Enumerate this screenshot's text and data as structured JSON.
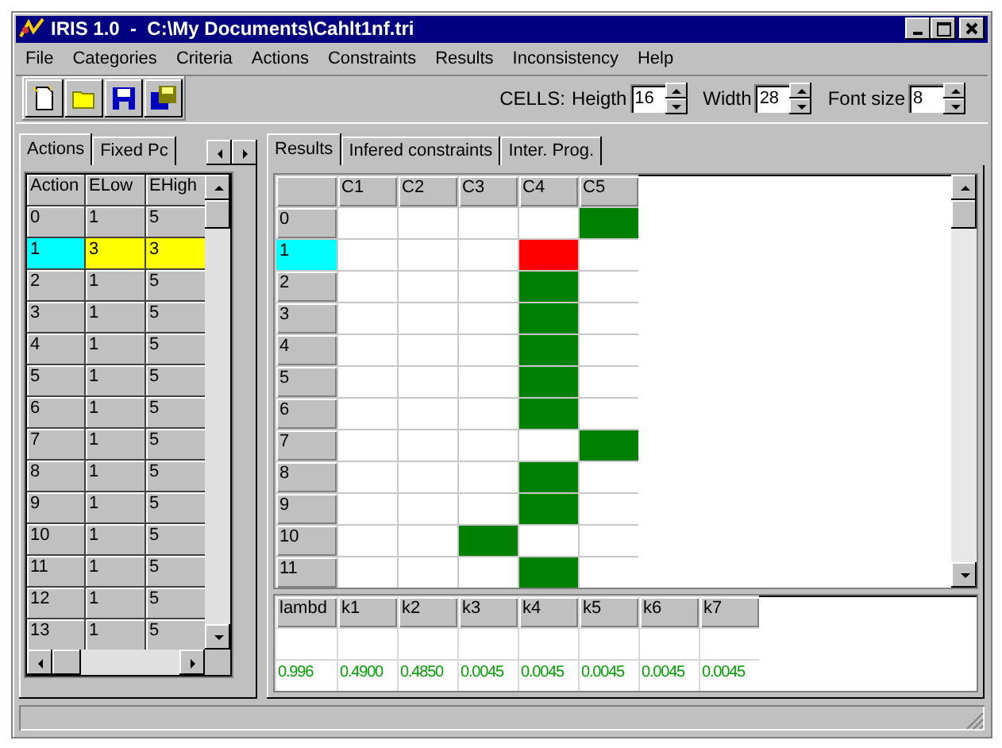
{
  "window": {
    "title": "IRIS 1.0  -  C:\\My Documents\\Cahlt1nf.tri"
  },
  "menu": [
    "File",
    "Categories",
    "Criteria",
    "Actions",
    "Constraints",
    "Results",
    "Inconsistency",
    "Help"
  ],
  "toolbar": {
    "cells_label": "CELLS:",
    "spinners": [
      {
        "label": "Heigth",
        "value": "16"
      },
      {
        "label": "Width",
        "value": "28"
      },
      {
        "label": "Font size",
        "value": "8"
      }
    ]
  },
  "left_tabs": [
    {
      "label": "Actions",
      "selected": true
    },
    {
      "label": "Fixed Pc",
      "selected": false
    }
  ],
  "actions_table": {
    "columns": [
      "Action",
      "ELow",
      "EHigh"
    ],
    "rows": [
      {
        "cells": [
          "0",
          "1",
          "5"
        ],
        "selected": false
      },
      {
        "cells": [
          "1",
          "3",
          "3"
        ],
        "selected": true
      },
      {
        "cells": [
          "2",
          "1",
          "5"
        ],
        "selected": false
      },
      {
        "cells": [
          "3",
          "1",
          "5"
        ],
        "selected": false
      },
      {
        "cells": [
          "4",
          "1",
          "5"
        ],
        "selected": false
      },
      {
        "cells": [
          "5",
          "1",
          "5"
        ],
        "selected": false
      },
      {
        "cells": [
          "6",
          "1",
          "5"
        ],
        "selected": false
      },
      {
        "cells": [
          "7",
          "1",
          "5"
        ],
        "selected": false
      },
      {
        "cells": [
          "8",
          "1",
          "5"
        ],
        "selected": false
      },
      {
        "cells": [
          "9",
          "1",
          "5"
        ],
        "selected": false
      },
      {
        "cells": [
          "10",
          "1",
          "5"
        ],
        "selected": false
      },
      {
        "cells": [
          "11",
          "1",
          "5"
        ],
        "selected": false
      },
      {
        "cells": [
          "12",
          "1",
          "5"
        ],
        "selected": false
      },
      {
        "cells": [
          "13",
          "1",
          "5"
        ],
        "selected": false
      }
    ]
  },
  "right_tabs": [
    {
      "label": "Results",
      "selected": true
    },
    {
      "label": "Infered constraints",
      "selected": false
    },
    {
      "label": "Inter. Prog.",
      "selected": false
    }
  ],
  "results_table": {
    "columns": [
      "C1",
      "C2",
      "C3",
      "C4",
      "C5"
    ],
    "rows": [
      {
        "label": "0",
        "selected": false,
        "cells": [
          {
            "color": "#ffffff"
          },
          {
            "color": "#ffffff"
          },
          {
            "color": "#ffffff"
          },
          {
            "color": "#ffffff"
          },
          {
            "color": "#008000"
          }
        ]
      },
      {
        "label": "1",
        "selected": true,
        "cells": [
          {
            "color": "#ffffff"
          },
          {
            "color": "#ffffff"
          },
          {
            "color": "#ffffff"
          },
          {
            "color": "#ff0000"
          },
          {
            "color": "#ffffff"
          }
        ]
      },
      {
        "label": "2",
        "selected": false,
        "cells": [
          {
            "color": "#ffffff"
          },
          {
            "color": "#ffffff"
          },
          {
            "color": "#ffffff"
          },
          {
            "color": "#008000"
          },
          {
            "color": "#ffffff"
          }
        ]
      },
      {
        "label": "3",
        "selected": false,
        "cells": [
          {
            "color": "#ffffff"
          },
          {
            "color": "#ffffff"
          },
          {
            "color": "#ffffff"
          },
          {
            "color": "#008000"
          },
          {
            "color": "#ffffff"
          }
        ]
      },
      {
        "label": "4",
        "selected": false,
        "cells": [
          {
            "color": "#ffffff"
          },
          {
            "color": "#ffffff"
          },
          {
            "color": "#ffffff"
          },
          {
            "color": "#008000"
          },
          {
            "color": "#ffffff"
          }
        ]
      },
      {
        "label": "5",
        "selected": false,
        "cells": [
          {
            "color": "#ffffff"
          },
          {
            "color": "#ffffff"
          },
          {
            "color": "#ffffff"
          },
          {
            "color": "#008000"
          },
          {
            "color": "#ffffff"
          }
        ]
      },
      {
        "label": "6",
        "selected": false,
        "cells": [
          {
            "color": "#ffffff"
          },
          {
            "color": "#ffffff"
          },
          {
            "color": "#ffffff"
          },
          {
            "color": "#008000"
          },
          {
            "color": "#ffffff"
          }
        ]
      },
      {
        "label": "7",
        "selected": false,
        "cells": [
          {
            "color": "#ffffff"
          },
          {
            "color": "#ffffff"
          },
          {
            "color": "#ffffff"
          },
          {
            "color": "#ffffff"
          },
          {
            "color": "#008000"
          }
        ]
      },
      {
        "label": "8",
        "selected": false,
        "cells": [
          {
            "color": "#ffffff"
          },
          {
            "color": "#ffffff"
          },
          {
            "color": "#ffffff"
          },
          {
            "color": "#008000"
          },
          {
            "color": "#ffffff"
          }
        ]
      },
      {
        "label": "9",
        "selected": false,
        "cells": [
          {
            "color": "#ffffff"
          },
          {
            "color": "#ffffff"
          },
          {
            "color": "#ffffff"
          },
          {
            "color": "#008000"
          },
          {
            "color": "#ffffff"
          }
        ]
      },
      {
        "label": "10",
        "selected": false,
        "cells": [
          {
            "color": "#ffffff"
          },
          {
            "color": "#ffffff"
          },
          {
            "color": "#008000"
          },
          {
            "color": "#ffffff"
          },
          {
            "color": "#ffffff"
          }
        ]
      },
      {
        "label": "11",
        "selected": false,
        "cells": [
          {
            "color": "#ffffff"
          },
          {
            "color": "#ffffff"
          },
          {
            "color": "#ffffff"
          },
          {
            "color": "#008000"
          },
          {
            "color": "#ffffff"
          }
        ]
      }
    ]
  },
  "lambda_table": {
    "columns": [
      "lambd",
      "k1",
      "k2",
      "k3",
      "k4",
      "k5",
      "k6",
      "k7"
    ],
    "values": [
      "0.996",
      "0.4900",
      "0.4850",
      "0.0045",
      "0.0045",
      "0.0045",
      "0.0045",
      "0.0045"
    ]
  }
}
